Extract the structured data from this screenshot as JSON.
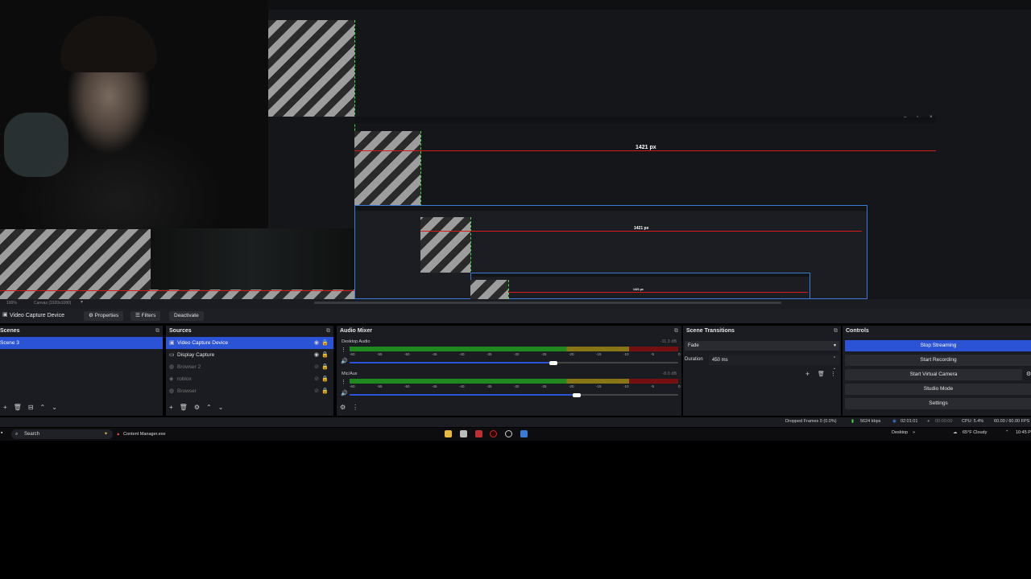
{
  "colors": {
    "accent": "#2b53d6",
    "guide_red": "#d61a1a",
    "guide_green": "#3ce23c",
    "bounding_blue": "#3b7bd8"
  },
  "preview": {
    "label_large": "1421 px",
    "label_medium": "1421 px",
    "label_small": "1421 px"
  },
  "zoombar": {
    "zoom": "100%",
    "canvas": "Canvas (1920x1080)"
  },
  "source_toolbar": {
    "current_source": "Video Capture Device",
    "properties": "Properties",
    "filters": "Filters",
    "deactivate": "Deactivate"
  },
  "scenes": {
    "title": "Scenes",
    "items": [
      "Scene 3"
    ]
  },
  "sources": {
    "title": "Sources",
    "items": [
      {
        "label": "Video Capture Device",
        "icon": "camera-icon"
      },
      {
        "label": "Display Capture",
        "icon": "monitor-icon"
      },
      {
        "label": "Browser 2",
        "icon": "globe-icon"
      },
      {
        "label": "roblox",
        "icon": "gamepad-icon"
      },
      {
        "label": "Browser",
        "icon": "globe-icon"
      }
    ]
  },
  "audio_mixer": {
    "title": "Audio Mixer",
    "tracks": [
      {
        "name": "Desktop Audio",
        "db": "-11.3 dB",
        "volume": 0.62
      },
      {
        "name": "Mic/Aux",
        "db": "-8.0 dB",
        "volume": 0.69
      }
    ],
    "ticks": [
      "-60",
      "-55",
      "-50",
      "-45",
      "-40",
      "-35",
      "-30",
      "-25",
      "-20",
      "-15",
      "-10",
      "-5",
      "0"
    ]
  },
  "scene_transitions": {
    "title": "Scene Transitions",
    "transition": "Fade",
    "duration_label": "Duration",
    "duration_value": "450 ms"
  },
  "controls": {
    "title": "Controls",
    "buttons": [
      "Stop Streaming",
      "Start Recording",
      "Start Virtual Camera",
      "Studio Mode",
      "Settings"
    ]
  },
  "status": {
    "dropped": "Dropped Frames 0 (0.0%)",
    "kbps": "5624 kbps",
    "stream_time": "02:01:01",
    "rec_time": "00:00:00",
    "cpu": "CPU: 5.4%",
    "fps": "60.00 / 60.00 FPS"
  },
  "taskbar": {
    "search": "Search",
    "app": "Content Manager.exe",
    "desktop": "Desktop",
    "weather": "65°F  Cloudy",
    "time": "10:45 P"
  }
}
